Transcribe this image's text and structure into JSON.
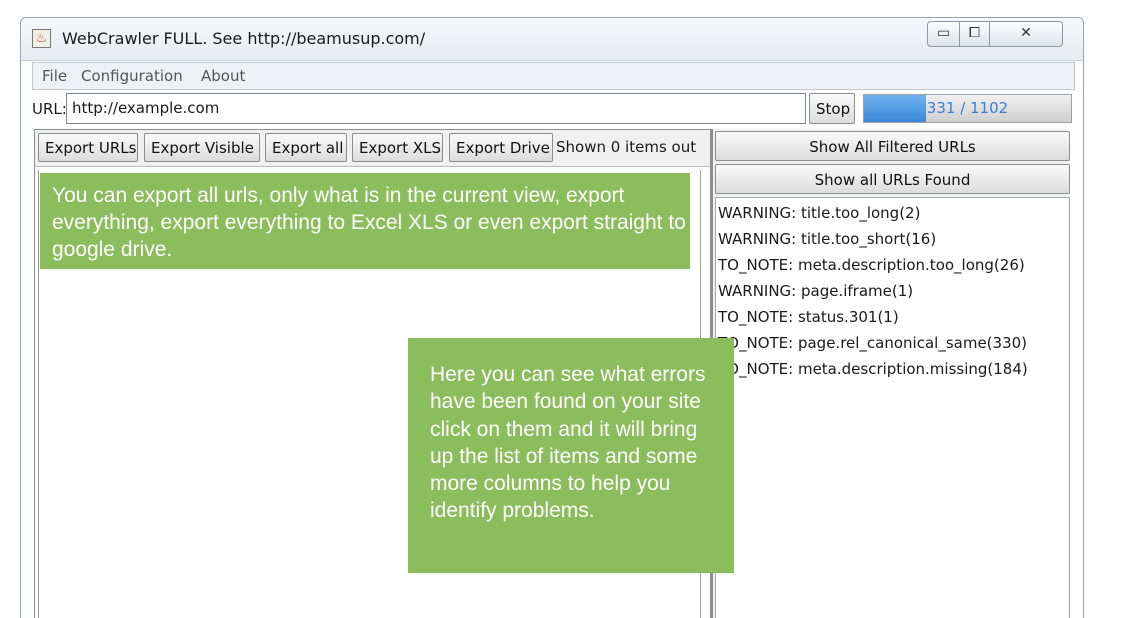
{
  "window": {
    "title": "WebCrawler FULL. See http://beamusup.com/",
    "controls": {
      "minimize": "▭",
      "maximize": "⧠",
      "close": "✕"
    }
  },
  "menu": {
    "items": [
      "File",
      "Configuration",
      "About"
    ]
  },
  "url_bar": {
    "label": "URL:",
    "value": "http://example.com",
    "stop_label": "Stop",
    "progress_text": "331 / 1102",
    "progress_done": 331,
    "progress_total": 1102
  },
  "export_bar": {
    "buttons": [
      "Export URLs",
      "Export Visible",
      "Export all",
      "Export XLS",
      "Export Drive"
    ],
    "shown_text": "Shown 0 items out"
  },
  "right_panel": {
    "show_filtered_label": "Show All Filtered URLs",
    "show_all_label": "Show all URLs Found",
    "issues": [
      "WARNING: title.too_long(2)",
      "WARNING: title.too_short(16)",
      "TO_NOTE: meta.description.too_long(26)",
      "WARNING: page.iframe(1)",
      "TO_NOTE: status.301(1)",
      "TO_NOTE: page.rel_canonical_same(330)",
      "TO_NOTE: meta.description.missing(184)"
    ]
  },
  "callouts": {
    "export": "You can export all urls, only what is in the current view, export everything, export everything to Excel XLS or even export straight to google drive.",
    "errors": "Here you can see what errors have been found on your site click on them and it will bring up the list of items and some more columns to help you identify problems.",
    "color": "#8cbd5d"
  },
  "colors": {
    "progress_fill": "#3a86d8",
    "callout": "#8cbd5d"
  }
}
